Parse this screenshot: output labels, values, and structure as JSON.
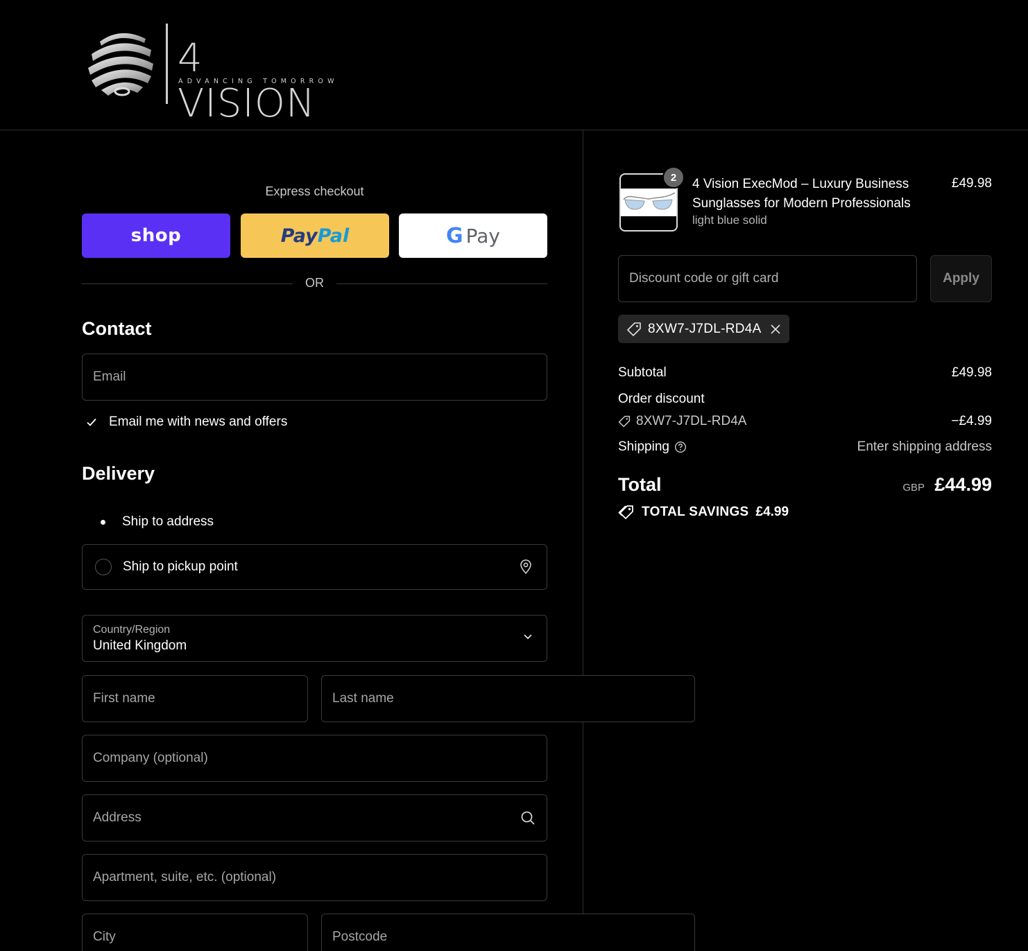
{
  "header": {
    "brand_name": "4 VISION",
    "tagline": "ADVANCING TOMORROW"
  },
  "express": {
    "title": "Express checkout",
    "shop_label": "shop",
    "paypal_part1": "Pay",
    "paypal_part2": "Pal",
    "gpay_g": "G",
    "gpay_label": "Pay",
    "or_label": "OR"
  },
  "contact": {
    "title": "Contact",
    "email_placeholder": "Email",
    "newsletter_label": "Email me with news and offers",
    "newsletter_checked": true
  },
  "delivery": {
    "title": "Delivery",
    "options": [
      {
        "label": "Ship to address",
        "selected": true
      },
      {
        "label": "Ship to pickup point",
        "selected": false
      }
    ],
    "country_label": "Country/Region",
    "country_value": "United Kingdom",
    "first_name_placeholder": "First name",
    "last_name_placeholder": "Last name",
    "company_placeholder": "Company (optional)",
    "address_placeholder": "Address",
    "apartment_placeholder": "Apartment, suite, etc. (optional)",
    "city_placeholder": "City",
    "postcode_placeholder": "Postcode"
  },
  "order": {
    "quantity": "2",
    "product_name": "4 Vision ExecMod – Luxury Business Sunglasses for Modern Professionals",
    "variant": "light blue solid",
    "price": "£49.98",
    "discount_placeholder": "Discount code or gift card",
    "apply_label": "Apply",
    "applied_code": "8XW7-J7DL-RD4A",
    "subtotal_label": "Subtotal",
    "subtotal_value": "£49.98",
    "order_discount_label": "Order discount",
    "discount_code": "8XW7-J7DL-RD4A",
    "discount_value": "−£4.99",
    "shipping_label": "Shipping",
    "shipping_value": "Enter shipping address",
    "total_label": "Total",
    "total_currency": "GBP",
    "total_value": "£44.99",
    "savings_label": "TOTAL SAVINGS",
    "savings_value": "£4.99"
  },
  "colors": {
    "background": "#000000",
    "shop_pay": "#5a31f4",
    "paypal": "#f6c657",
    "border": "#3a3a3a"
  }
}
